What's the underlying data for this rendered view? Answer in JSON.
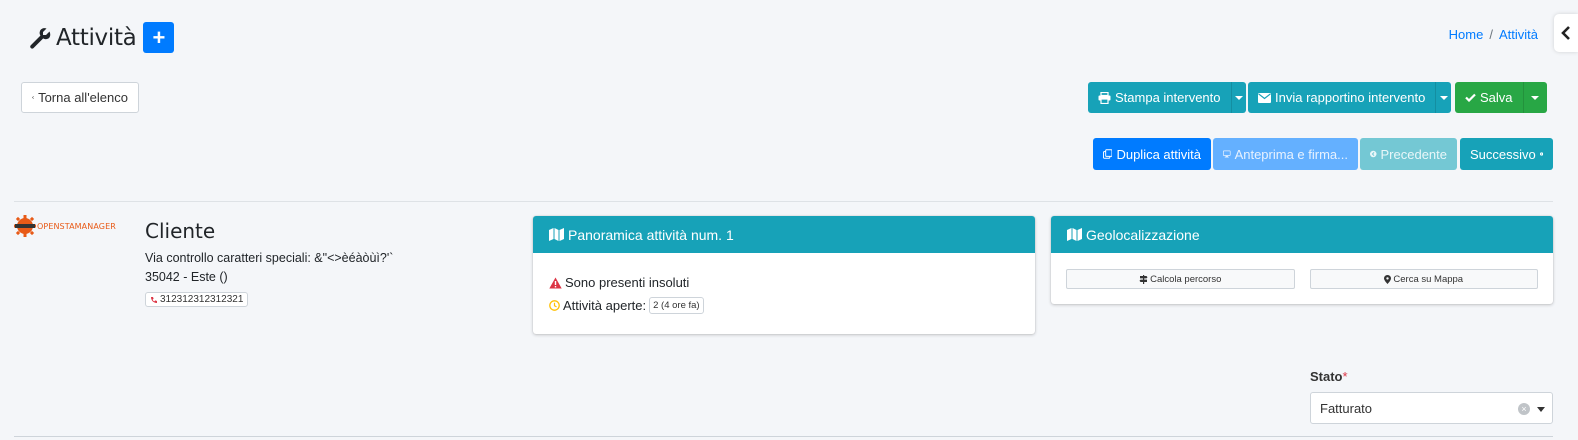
{
  "header": {
    "title": "Attività",
    "add_label": "+",
    "breadcrumb": [
      "Home",
      "/",
      "Attività"
    ]
  },
  "toolbar": {
    "back_label": "Torna all'elenco",
    "print_label": "Stampa intervento",
    "send_label": "Invia rapportino intervento",
    "save_label": "Salva",
    "duplicate_label": "Duplica attività",
    "preview_label": "Anteprima e firma...",
    "prev_label": "Precedente",
    "next_label": "Successivo"
  },
  "logo": {
    "text": "OpenSTAManager",
    "tag": "OPENSTAMANAGER"
  },
  "client": {
    "heading": "Cliente",
    "address": "Via controllo caratteri speciali: &\"<>èéàòùì?'`",
    "city": "35042 - Este ()",
    "phone": "312312312312321"
  },
  "overview": {
    "title": "Panoramica attività num. 1",
    "unpaid": "Sono presenti insoluti",
    "open_label": "Attività aperte:",
    "open_badge": "2 (4 ore fa)"
  },
  "geo": {
    "title": "Geolocalizzazione",
    "route_label": "Calcola percorso",
    "map_label": "Cerca su Mappa"
  },
  "form": {
    "stato_label": "Stato",
    "required_mark": "*",
    "stato_value": "Fatturato"
  },
  "colors": {
    "primary": "#007bff",
    "info": "#17a2b8",
    "success": "#28a745",
    "danger": "#dc3545",
    "warning": "#ffc107",
    "background": "#f4f6f9"
  }
}
